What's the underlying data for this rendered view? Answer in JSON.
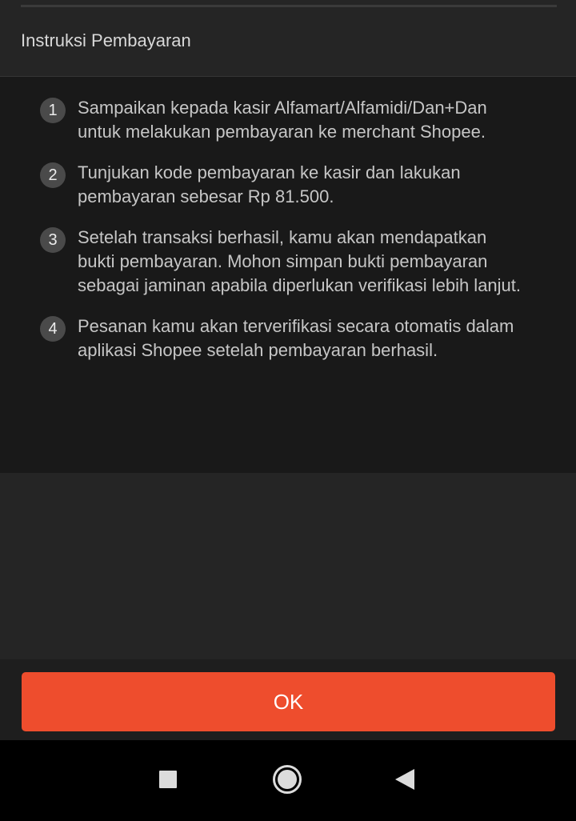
{
  "dialog": {
    "title": "Instruksi Pembayaran",
    "steps": [
      {
        "number": "1",
        "text": "Sampaikan kepada kasir Alfamart/Alfamidi/Dan+Dan untuk melakukan pembayaran ke merchant Shopee."
      },
      {
        "number": "2",
        "text": "Tunjukan kode pembayaran ke kasir dan lakukan pembayaran sebesar Rp 81.500."
      },
      {
        "number": "3",
        "text": "Setelah transaksi berhasil, kamu akan mendapatkan bukti pembayaran. Mohon simpan bukti pembayaran sebagai jaminan apabila diperlukan verifikasi lebih lanjut."
      },
      {
        "number": "4",
        "text": "Pesanan kamu akan terverifikasi secara otomatis dalam aplikasi Shopee setelah pembayaran berhasil."
      }
    ],
    "ok_label": "OK"
  },
  "nav_bar": {
    "recent_icon": "square-recent-apps-icon",
    "home_icon": "circle-home-icon",
    "back_icon": "triangle-back-icon"
  },
  "colors": {
    "accent": "#ee4d2d",
    "panel_background": "#191919",
    "page_background": "#252525"
  }
}
